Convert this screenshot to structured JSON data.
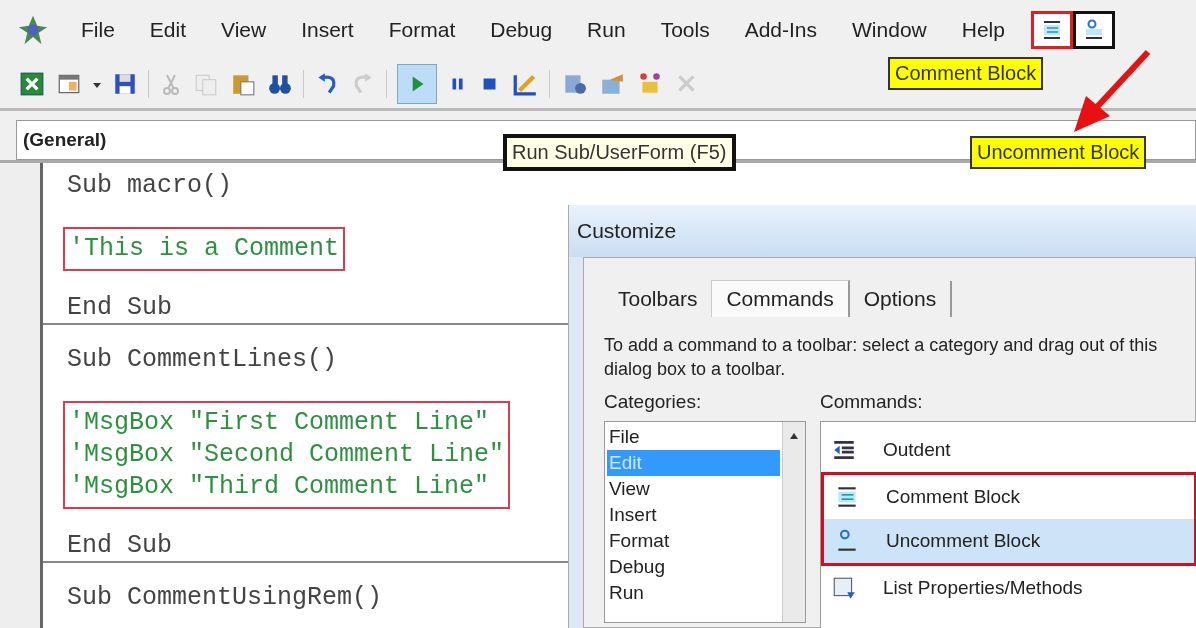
{
  "menu": [
    {
      "label": "File"
    },
    {
      "label": "Edit"
    },
    {
      "label": "View"
    },
    {
      "label": "Insert"
    },
    {
      "label": "Format"
    },
    {
      "label": "Debug"
    },
    {
      "label": "Run"
    },
    {
      "label": "Tools"
    },
    {
      "label": "Add-Ins"
    },
    {
      "label": "Window"
    },
    {
      "label": "Help"
    }
  ],
  "object_box": {
    "value": "(General)"
  },
  "code": [
    {
      "kind": "line",
      "text": "Sub macro()"
    },
    {
      "kind": "boxed_comment",
      "lines": [
        "'This is a Comment"
      ]
    },
    {
      "kind": "line",
      "text": "End Sub"
    },
    {
      "kind": "divider"
    },
    {
      "kind": "line",
      "text": "Sub CommentLines()"
    },
    {
      "kind": "boxed_comment",
      "lines": [
        "'MsgBox \"First Comment Line\"",
        "'MsgBox \"Second Comment Line\"",
        "'MsgBox \"Third Comment Line\""
      ]
    },
    {
      "kind": "line",
      "text": "End Sub"
    },
    {
      "kind": "divider"
    },
    {
      "kind": "line",
      "text": "Sub CommentUsingRem()"
    }
  ],
  "dialog": {
    "title": "Customize",
    "tabs": [
      {
        "label": "Toolbars",
        "selected": false
      },
      {
        "label": "Commands",
        "selected": true
      },
      {
        "label": "Options",
        "selected": false
      }
    ],
    "description": "To add a command to a toolbar: select a category and drag out of this dialog box to a toolbar.",
    "categories_label": "Categories:",
    "categories": [
      {
        "label": "File",
        "selected": false
      },
      {
        "label": "Edit",
        "selected": true
      },
      {
        "label": "View",
        "selected": false
      },
      {
        "label": "Insert",
        "selected": false
      },
      {
        "label": "Format",
        "selected": false
      },
      {
        "label": "Debug",
        "selected": false
      },
      {
        "label": "Run",
        "selected": false
      }
    ],
    "commands_label": "Commands:",
    "commands": [
      {
        "label": "Outdent",
        "selected": false,
        "highlighted": false
      },
      {
        "label": "Comment Block",
        "selected": false,
        "highlighted": true
      },
      {
        "label": "Uncomment Block",
        "selected": true,
        "highlighted": true
      },
      {
        "label": "List Properties/Methods",
        "selected": false,
        "highlighted": false
      }
    ]
  },
  "callouts": [
    {
      "kind": "yellow",
      "text": "Comment Block"
    },
    {
      "kind": "tooltip",
      "text": "Run Sub/UserForm (F5)"
    },
    {
      "kind": "yellow",
      "text": "Uncomment Block"
    }
  ]
}
